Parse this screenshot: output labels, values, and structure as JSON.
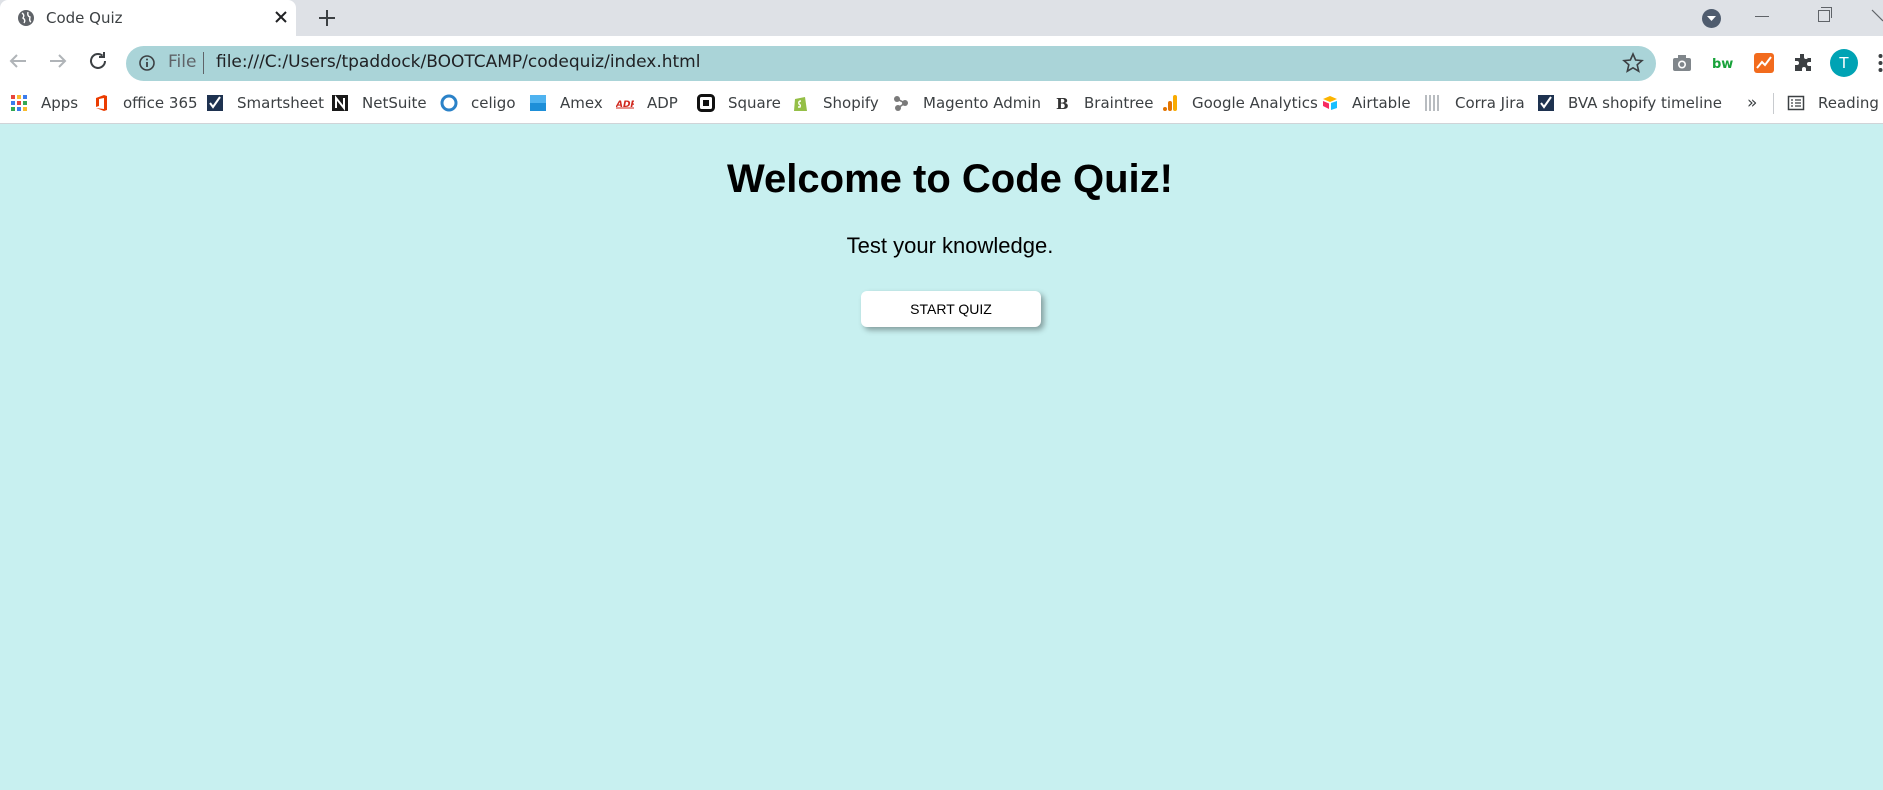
{
  "browser": {
    "tab": {
      "title": "Code Quiz"
    },
    "new_tab_symbol": "+",
    "omnibox": {
      "scheme_label": "File",
      "url": "file:///C:/Users/tpaddock/BOOTCAMP/codequiz/index.html"
    },
    "profile_initial": "T",
    "icons": [
      "globe-icon",
      "close-icon",
      "plus-icon",
      "back-icon",
      "forward-icon",
      "reload-icon",
      "info-icon",
      "star-icon",
      "camera-icon",
      "extensions-icon",
      "menu-icon"
    ]
  },
  "bookmarks": [
    {
      "label": "Apps",
      "icon": "apps-grid-icon",
      "color": "#e8453c"
    },
    {
      "label": "office 365",
      "icon": "office-icon",
      "color": "#eb3c00"
    },
    {
      "label": "Smartsheet",
      "icon": "smartsheet-icon",
      "color": "#1e3250"
    },
    {
      "label": "NetSuite",
      "icon": "netsuite-icon",
      "color": "#1a1a1a"
    },
    {
      "label": "celigo",
      "icon": "celigo-icon",
      "color": "#2b82c8"
    },
    {
      "label": "Amex",
      "icon": "amex-icon",
      "color": "#1e8fd8"
    },
    {
      "label": "ADP",
      "icon": "adp-icon",
      "color": "#d0271d"
    },
    {
      "label": "Square",
      "icon": "square-icon",
      "color": "#111111"
    },
    {
      "label": "Shopify",
      "icon": "shopify-icon",
      "color": "#95bf47"
    },
    {
      "label": "Magento Admin",
      "icon": "magento-icon",
      "color": "#7a7a7a"
    },
    {
      "label": "Braintree",
      "icon": "braintree-icon",
      "color": "#333333"
    },
    {
      "label": "Google Analytics",
      "icon": "analytics-icon",
      "color": "#f9ab00"
    },
    {
      "label": "Airtable",
      "icon": "airtable-icon",
      "color": "#fcb400"
    },
    {
      "label": "Corra Jira",
      "icon": "jira-icon",
      "color": "#9aa0a6"
    },
    {
      "label": "BVA shopify timeline",
      "icon": "smartsheet-icon",
      "color": "#1e3250"
    }
  ],
  "bookmarks_overflow": "»",
  "reading_list": {
    "label": "Reading lis",
    "icon": "reading-list-icon"
  },
  "page": {
    "heading": "Welcome to Code Quiz!",
    "subheading": "Test your knowledge.",
    "start_button": "START QUIZ",
    "background": "#c8f0f0"
  }
}
